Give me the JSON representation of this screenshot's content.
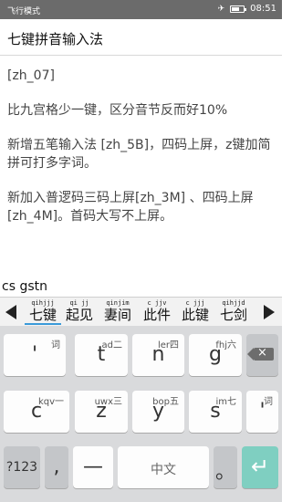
{
  "status_bar": {
    "mode": "飞行模式",
    "time": "08:51",
    "icons": [
      "airplane-icon",
      "battery-icon"
    ]
  },
  "app": {
    "title": "七键拼音输入法"
  },
  "content": {
    "paragraphs": [
      "[zh_07]",
      "比九宫格少一键，区分音节反而好10%",
      "新增五笔输入法 [zh_5B]，四码上屏，z键加简拼可打多字词。",
      "新加入普逻码三码上屏[zh_3M] 、四码上屏 [zh_4M]。首码大写不上屏。"
    ]
  },
  "ime": {
    "composing": "cs gstn",
    "candidates": [
      {
        "code": "qihjjj",
        "word": "七键"
      },
      {
        "code": "qi jj",
        "word": "起见"
      },
      {
        "code": "qinjim",
        "word": "妻间"
      },
      {
        "code": "c jjv",
        "word": "此件"
      },
      {
        "code": "c jjj",
        "word": "此键"
      },
      {
        "code": "qihjjd",
        "word": "七剑"
      }
    ],
    "keys": {
      "r1": [
        {
          "main": "'",
          "hint": "词"
        },
        {
          "main": "t",
          "hint": "ad二"
        },
        {
          "main": "n",
          "hint": "ler四"
        },
        {
          "main": "g",
          "hint": "fhj六"
        }
      ],
      "r2": [
        {
          "main": "c",
          "hint": "kqv一"
        },
        {
          "main": "z",
          "hint": "uwx三"
        },
        {
          "main": "y",
          "hint": "bop五"
        },
        {
          "main": "s",
          "hint": "im七"
        },
        {
          "main": "'",
          "hint": "词"
        }
      ],
      "r3": {
        "sym": "?123",
        "comma": ",",
        "space_left": "—",
        "space": "中文",
        "period": "。",
        "enter": "↵"
      }
    }
  }
}
